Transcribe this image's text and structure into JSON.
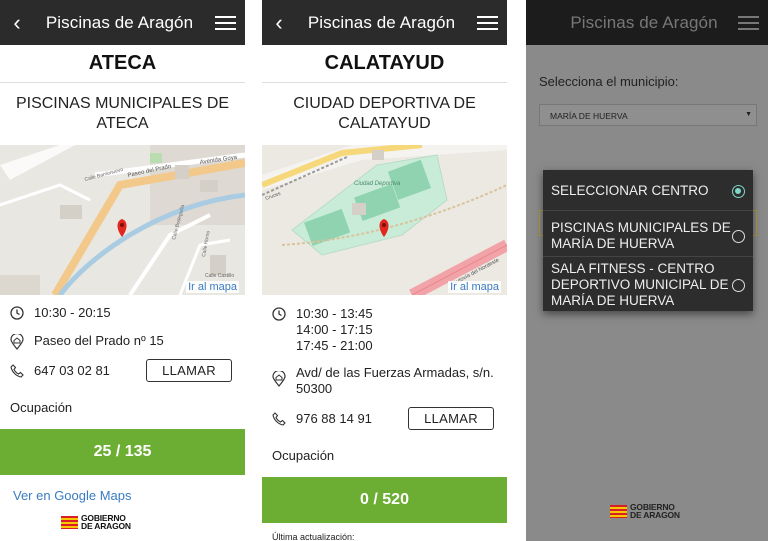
{
  "app": {
    "title": "Piscinas de Aragón"
  },
  "logo": {
    "line1": "GOBIERNO",
    "line2": "DE ARAGON"
  },
  "screen1": {
    "town": "ATECA",
    "center": "PISCINAS MUNICIPALES DE ATECA",
    "map_link": "Ir al mapa",
    "map_labels": {
      "road1": "Paseo del Prado",
      "road2": "Avenida Goya",
      "road3": "Calle Barrionuevo",
      "road4": "Calle Bodeguilla",
      "road5": "Calle Horno",
      "road6": "Calle Castillo"
    },
    "hours": [
      "10:30 - 20:15"
    ],
    "address": "Paseo del Prado nº 15",
    "phone": "647 03 02 81",
    "call_label": "LLAMAR",
    "occupancy_label": "Ocupación",
    "occupancy_value": "25 / 135",
    "gmaps_link": "Ver en Google Maps"
  },
  "screen2": {
    "town": "CALATAYUD",
    "center": "CIUDAD DEPORTIVA DE CALATAYUD",
    "map_link": "Ir al mapa",
    "map_labels": {
      "place": "Ciudad Deportiva",
      "road1": "Autovía del Nordeste",
      "road2": "Cruces"
    },
    "hours": [
      "10:30 - 13:45",
      "14:00 - 17:15",
      "17:45 - 21:00"
    ],
    "address": "Avd/ de las Fuerzas Armadas, s/n. 50300",
    "phone": "976 88 14 91",
    "call_label": "LLAMAR",
    "occupancy_label": "Ocupación",
    "occupancy_value": "0 / 520",
    "updated_label": "Última actualización:"
  },
  "screen3": {
    "municipality_label": "Selecciona el municipio:",
    "municipality_value": "MARÍA DE HUERVA",
    "dialog_options": [
      {
        "label": "SELECCIONAR CENTRO",
        "selected": true
      },
      {
        "label": "PISCINAS MUNICIPALES DE MARÍA DE HUERVA",
        "selected": false
      },
      {
        "label": "SALA FITNESS - CENTRO DEPORTIVO MUNICIPAL DE MARÍA DE HUERVA",
        "selected": false
      }
    ]
  },
  "colors": {
    "appbar": "#2b2b2b",
    "occupancy": "#6cae33",
    "link": "#3a7cc3",
    "radio_selected": "#7fd6c9"
  }
}
